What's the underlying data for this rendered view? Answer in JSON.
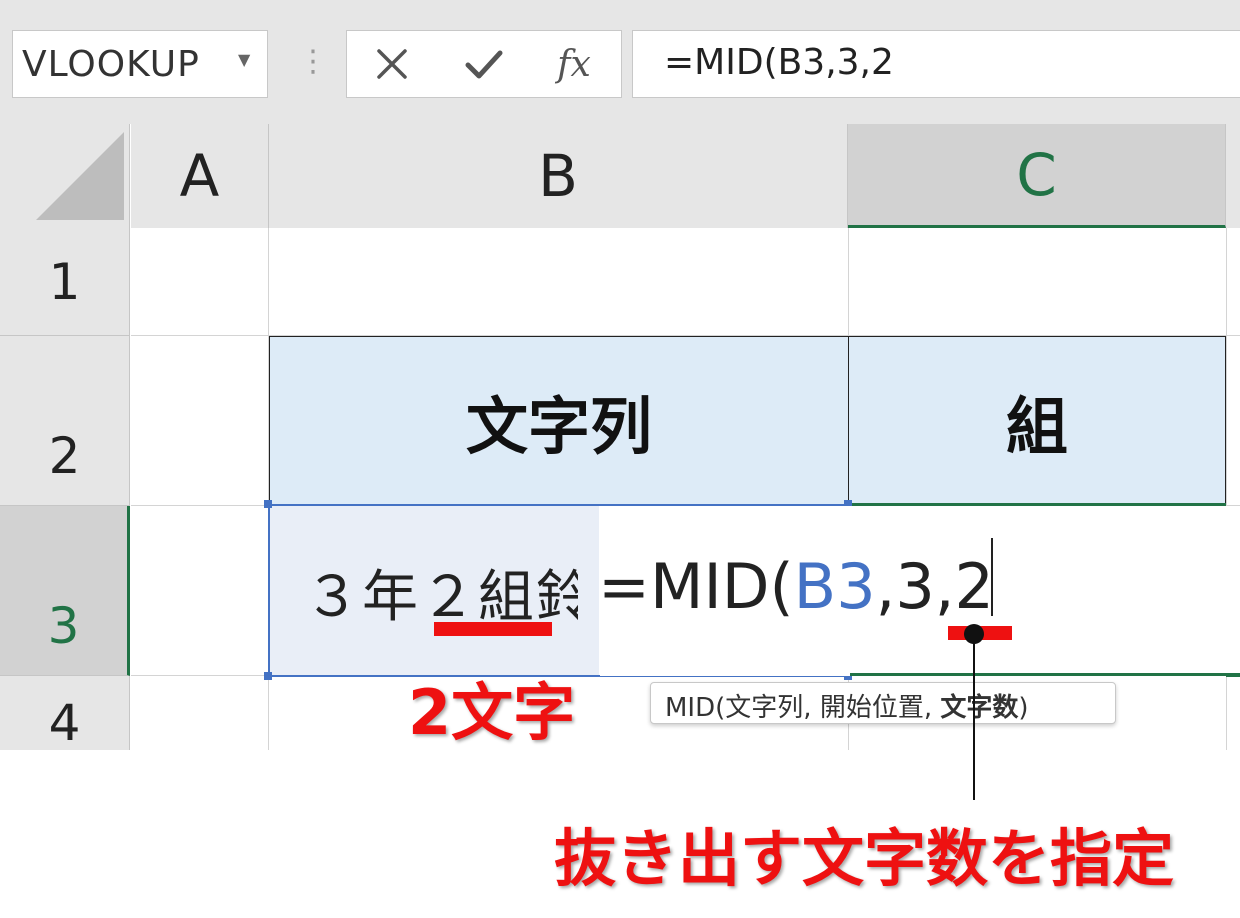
{
  "formula_bar": {
    "name_box": "VLOOKUP",
    "cancel_glyph": "✕",
    "enter_glyph": "✔",
    "fx_label": "fx",
    "formula": "=MID(B3,3,2"
  },
  "columns": [
    "A",
    "B",
    "C"
  ],
  "rows": [
    "1",
    "2",
    "3",
    "4"
  ],
  "table": {
    "header_b": "文字列",
    "header_c": "組",
    "b3_value": "３年２組",
    "b3_overflow": "鈴"
  },
  "edit": {
    "func": "=MID(",
    "ref": "B3",
    "rest": ",3,2"
  },
  "tooltip": {
    "func": "MID(",
    "arg1": "文字列",
    "sep1": ", ",
    "arg2": "開始位置",
    "sep2": ", ",
    "arg3": "文字数",
    "close": ")"
  },
  "annotations": {
    "two_chars": "2文字",
    "callout": "抜き出す文字数を指定"
  },
  "colors": {
    "accent_green": "#217346",
    "header_fill": "#ddebf7",
    "edit_border": "#4472c4",
    "ref_blue": "#4472c4",
    "annotation_red": "#ee1111"
  }
}
